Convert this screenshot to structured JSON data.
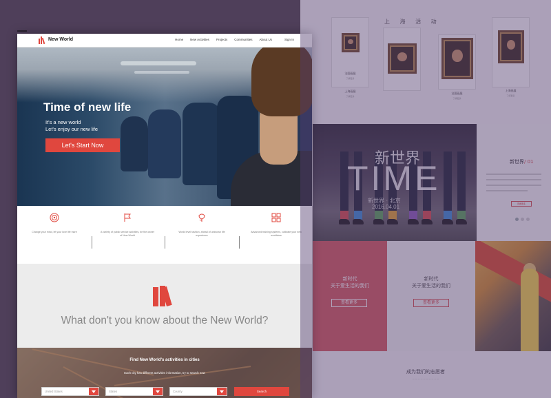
{
  "front": {
    "nav": {
      "brand": "New World",
      "links": [
        "Home",
        "New Activities",
        "Projects",
        "Communities",
        "About Us",
        "Sign In"
      ]
    },
    "hero": {
      "title": "Time of new life",
      "line1": "It's a new world",
      "line2": "Let's enjoy our new life",
      "cta": "Let's Start Now"
    },
    "features": [
      {
        "icon": "target-icon",
        "text": "Change your mind, let your love life more"
      },
      {
        "icon": "flag-icon",
        "text": "A variety of public service activities, be the owner of New World"
      },
      {
        "icon": "flower-icon",
        "text": "World level fashion, ahead of unknown life experience"
      },
      {
        "icon": "grid-icon",
        "text": "Advanced training systems, cultivate your new worldview"
      }
    ],
    "know": {
      "icon": "books-icon",
      "title": "What don't you know about the New World?"
    },
    "cities": {
      "title": "Find New World's activities in cities",
      "subtitle": "Each city has different activities information, try to search now",
      "country": "United States",
      "state": "States",
      "county": "County",
      "search": "Search"
    }
  },
  "back": {
    "section_title": "上 海 活 动",
    "gallery": [
      {
        "caption": "法国画展",
        "sub": "了解更多"
      },
      {
        "caption": "上海画展",
        "sub": "了解更多"
      },
      {
        "caption": "法国画展",
        "sub": "了解更多"
      },
      {
        "caption": "上海画展",
        "sub": "了解更多"
      }
    ],
    "banner": {
      "cn": "新世界",
      "big": "TIME",
      "sub": "新世界 · 北京",
      "date": "2016.04.01"
    },
    "side": {
      "title": "新世界",
      "num": "/ 01",
      "button": "查看更多"
    },
    "red_card": {
      "line1": "新时代",
      "line2": "关于爱生活的我们",
      "button": "查看更多"
    },
    "grey_card": {
      "line1": "新时代",
      "line2": "关于爱生活的我们",
      "button": "查看更多"
    },
    "footer_title": "成为我们的志愿者"
  },
  "colors": {
    "accent": "#e0473e",
    "backdrop": "#4f3f5a",
    "section_grey": "#ececec"
  }
}
